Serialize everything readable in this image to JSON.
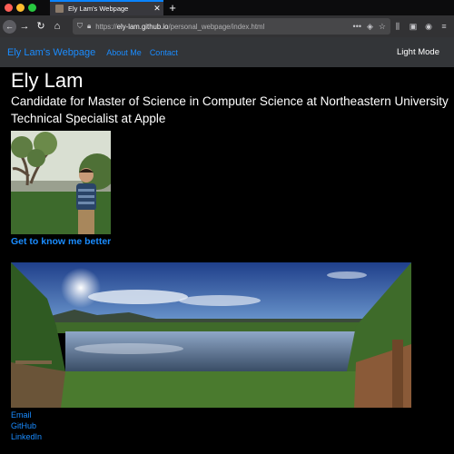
{
  "browser": {
    "tab_title": "Ely Lam's Webpage",
    "tab_close": "✕",
    "new_tab": "+",
    "url_scheme": "https://",
    "url_host": "ely-lam.github.io",
    "url_path": "/personal_webpage/index.html",
    "url_more": "•••"
  },
  "site_nav": {
    "brand": "Ely Lam's Webpage",
    "links": [
      "About Me",
      "Contact"
    ],
    "mode_toggle": "Light Mode"
  },
  "header": {
    "name": "Ely Lam",
    "subtitle": "Candidate for Master of Science in Computer Science at Northeastern University",
    "role": "Technical Specialist at Apple"
  },
  "about_link": "Get to know me better",
  "contact_links": [
    "Email",
    "GitHub",
    "LinkedIn"
  ],
  "colors": {
    "link": "#1a8cff",
    "nav_bg": "#333538",
    "page_bg": "#000000"
  }
}
